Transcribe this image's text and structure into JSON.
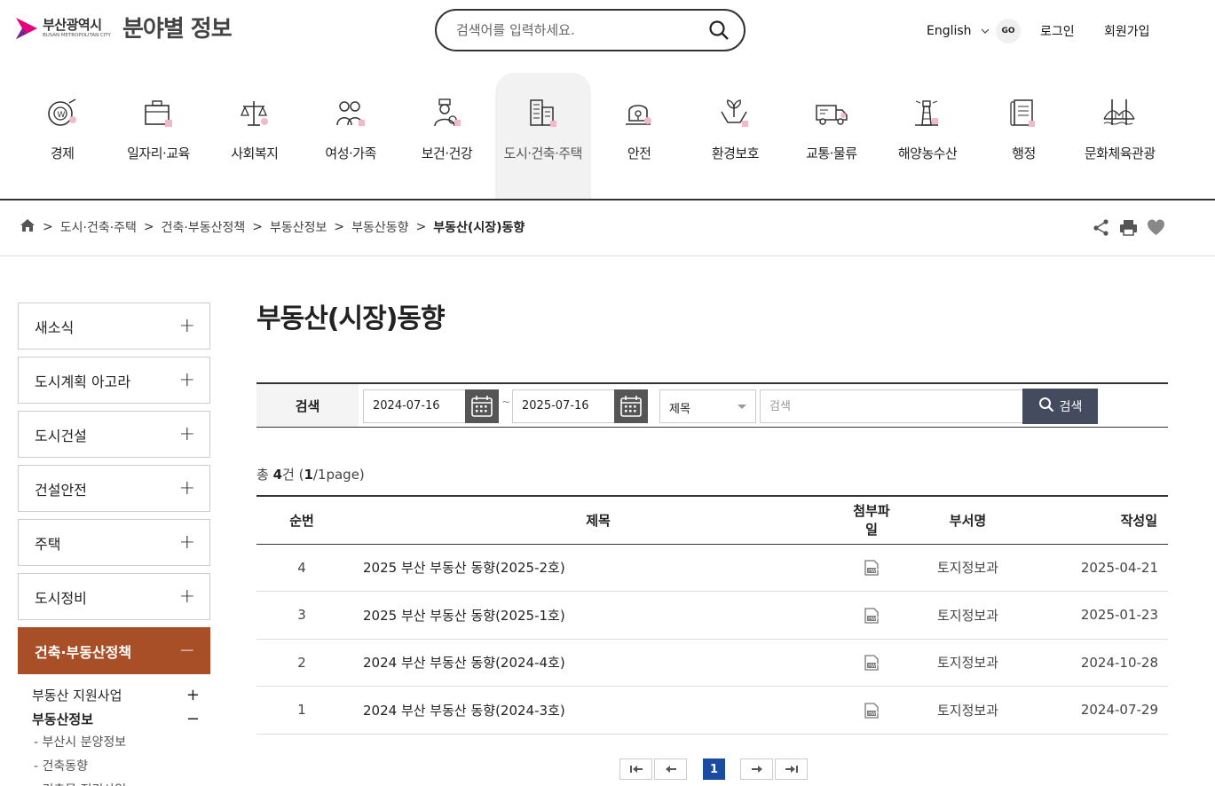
{
  "header": {
    "logo_kor": "부산광역시",
    "logo_eng": "BUSAN METROPOLITAN CITY",
    "site_title": "분야별 정보",
    "search_placeholder": "검색어를 입력하세요.",
    "lang_label": "English",
    "go_label": "GO",
    "login_label": "로그인",
    "join_label": "회원가입"
  },
  "gnb": {
    "items": [
      {
        "label": "경제",
        "icon": "economy-icon"
      },
      {
        "label": "일자리·교육",
        "icon": "briefcase-icon"
      },
      {
        "label": "사회복지",
        "icon": "scale-icon"
      },
      {
        "label": "여성·가족",
        "icon": "family-icon"
      },
      {
        "label": "보건·건강",
        "icon": "doctor-icon"
      },
      {
        "label": "도시·건축·주택",
        "icon": "building-icon"
      },
      {
        "label": "안전",
        "icon": "siren-icon"
      },
      {
        "label": "환경보호",
        "icon": "plant-hands-icon"
      },
      {
        "label": "교통·물류",
        "icon": "truck-icon"
      },
      {
        "label": "해양농수산",
        "icon": "lighthouse-icon"
      },
      {
        "label": "행정",
        "icon": "document-icon"
      },
      {
        "label": "문화체육관광",
        "icon": "bridge-icon"
      }
    ]
  },
  "breadcrumb": {
    "items": [
      "도시·건축·주택",
      "건축·부동산정책",
      "부동산정보",
      "부동산동향"
    ],
    "current": "부동산(시장)동향",
    "sep": ">"
  },
  "lnb": {
    "items": [
      {
        "label": "새소식",
        "toggle": "+"
      },
      {
        "label": "도시계획 아고라",
        "toggle": "+"
      },
      {
        "label": "도시건설",
        "toggle": "+"
      },
      {
        "label": "건설안전",
        "toggle": "+"
      },
      {
        "label": "주택",
        "toggle": "+"
      },
      {
        "label": "도시정비",
        "toggle": "+"
      },
      {
        "label": "건축·부동산정책",
        "toggle": "−"
      }
    ],
    "sub": [
      {
        "label": "부동산 지원사업",
        "toggle": "+"
      },
      {
        "label": "부동산정보",
        "toggle": "−"
      }
    ],
    "sub3": [
      "- 부산시 분양정보",
      "- 건축동향",
      "- 건축물 정리사업"
    ]
  },
  "content": {
    "page_title": "부동산(시장)동향",
    "filter": {
      "label": "검색",
      "date_from": "2024-07-16",
      "date_to": "2025-07-16",
      "tilde": "~",
      "select_value": "제목",
      "keyword_placeholder": "검색",
      "submit_label": "검색"
    },
    "total": {
      "prefix": "총 ",
      "count": "4",
      "unit": "건 (",
      "page": "1",
      "suffix": "/1page)"
    },
    "table": {
      "headers": [
        "순번",
        "제목",
        "첨부파일",
        "부서명",
        "작성일"
      ],
      "rows": [
        {
          "no": "4",
          "title": "2025 부산 부동산 동향(2025-2호)",
          "dept": "토지정보과",
          "date": "2025-04-21"
        },
        {
          "no": "3",
          "title": "2025 부산 부동산 동향(2025-1호)",
          "dept": "토지정보과",
          "date": "2025-01-23"
        },
        {
          "no": "2",
          "title": "2024 부산 부동산 동향(2024-4호)",
          "dept": "토지정보과",
          "date": "2024-10-28"
        },
        {
          "no": "1",
          "title": "2024 부산 부동산 동향(2024-3호)",
          "dept": "토지정보과",
          "date": "2024-07-29"
        }
      ]
    },
    "pagination": {
      "current": "1"
    }
  },
  "colors": {
    "accent": "#a94f27",
    "pager": "#1a4ba0",
    "search_btn": "#444b5e",
    "logo_pink": "#e6007e"
  }
}
